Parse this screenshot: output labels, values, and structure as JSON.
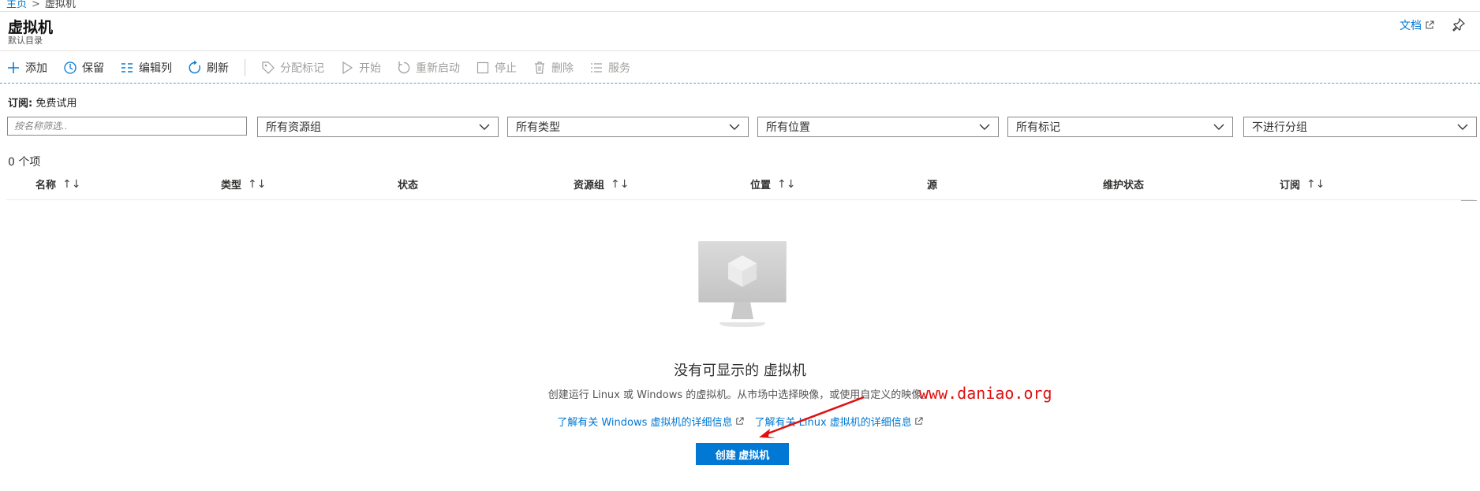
{
  "breadcrumb": {
    "home": "主页",
    "separator": ">",
    "current": "虚拟机"
  },
  "page": {
    "title": "虚拟机",
    "subtitle": "默认目录"
  },
  "header": {
    "docs_label": "文档"
  },
  "toolbar": {
    "add": "添加",
    "reserve": "保留",
    "edit_columns": "编辑列",
    "refresh": "刷新",
    "assign_tags": "分配标记",
    "start": "开始",
    "restart": "重新启动",
    "stop": "停止",
    "delete": "删除",
    "services": "服务"
  },
  "subscription": {
    "label": "订阅:",
    "value": "免费试用"
  },
  "filters": {
    "name_placeholder": "按名称筛选..",
    "resource_group": "所有资源组",
    "type": "所有类型",
    "location": "所有位置",
    "tags": "所有标记",
    "grouping": "不进行分组"
  },
  "item_count": "0 个项",
  "table": {
    "columns": [
      {
        "label": "名称",
        "sortable": true
      },
      {
        "label": "类型",
        "sortable": true
      },
      {
        "label": "状态",
        "sortable": false
      },
      {
        "label": "资源组",
        "sortable": true
      },
      {
        "label": "位置",
        "sortable": true
      },
      {
        "label": "源",
        "sortable": false
      },
      {
        "label": "维护状态",
        "sortable": false
      },
      {
        "label": "订阅",
        "sortable": true
      }
    ],
    "sort_glyph": "↑↓"
  },
  "empty_state": {
    "title": "没有可显示的 虚拟机",
    "description": "创建运行 Linux 或 Windows 的虚拟机。从市场中选择映像，或使用自定义的映像。",
    "link_windows": "了解有关 Windows 虚拟机的详细信息",
    "link_linux": "了解有关 Linux 虚拟机的详细信息",
    "create_button": "创建 虚拟机"
  },
  "watermark": "www.daniao.org",
  "colors": {
    "accent": "#0078d4",
    "watermark": "#e01010"
  }
}
